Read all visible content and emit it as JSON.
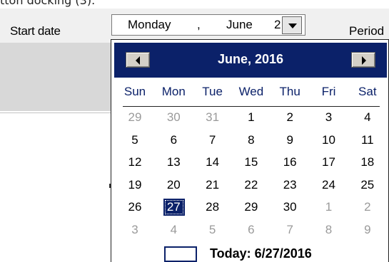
{
  "caption": "tton docking (3).",
  "toolbar": {
    "start_date_label": "Start date",
    "period_label": "Period"
  },
  "date_picker": {
    "day_of_week": "Monday",
    "separator": ",",
    "month": "June",
    "day_fragment": "2"
  },
  "calendar": {
    "title": "June, 2016",
    "weekdays": [
      "Sun",
      "Mon",
      "Tue",
      "Wed",
      "Thu",
      "Fri",
      "Sat"
    ],
    "weeks": [
      [
        {
          "d": "29",
          "other": true
        },
        {
          "d": "30",
          "other": true
        },
        {
          "d": "31",
          "other": true
        },
        {
          "d": "1"
        },
        {
          "d": "2"
        },
        {
          "d": "3"
        },
        {
          "d": "4"
        }
      ],
      [
        {
          "d": "5"
        },
        {
          "d": "6"
        },
        {
          "d": "7"
        },
        {
          "d": "8"
        },
        {
          "d": "9"
        },
        {
          "d": "10"
        },
        {
          "d": "11"
        }
      ],
      [
        {
          "d": "12"
        },
        {
          "d": "13"
        },
        {
          "d": "14"
        },
        {
          "d": "15"
        },
        {
          "d": "16"
        },
        {
          "d": "17"
        },
        {
          "d": "18"
        }
      ],
      [
        {
          "d": "19"
        },
        {
          "d": "20"
        },
        {
          "d": "21"
        },
        {
          "d": "22"
        },
        {
          "d": "23"
        },
        {
          "d": "24"
        },
        {
          "d": "25"
        }
      ],
      [
        {
          "d": "26"
        },
        {
          "d": "27",
          "selected": true
        },
        {
          "d": "28"
        },
        {
          "d": "29"
        },
        {
          "d": "30"
        },
        {
          "d": "1",
          "other": true
        },
        {
          "d": "2",
          "other": true
        }
      ],
      [
        {
          "d": "3",
          "other": true
        },
        {
          "d": "4",
          "other": true
        },
        {
          "d": "5",
          "other": true
        },
        {
          "d": "6",
          "other": true
        },
        {
          "d": "7",
          "other": true
        },
        {
          "d": "8",
          "other": true
        },
        {
          "d": "9",
          "other": true
        }
      ]
    ],
    "today_label": "Today: 6/27/2016"
  },
  "colors": {
    "header_navy": "#0b2169",
    "other_month_gray": "#9a9a9a"
  }
}
